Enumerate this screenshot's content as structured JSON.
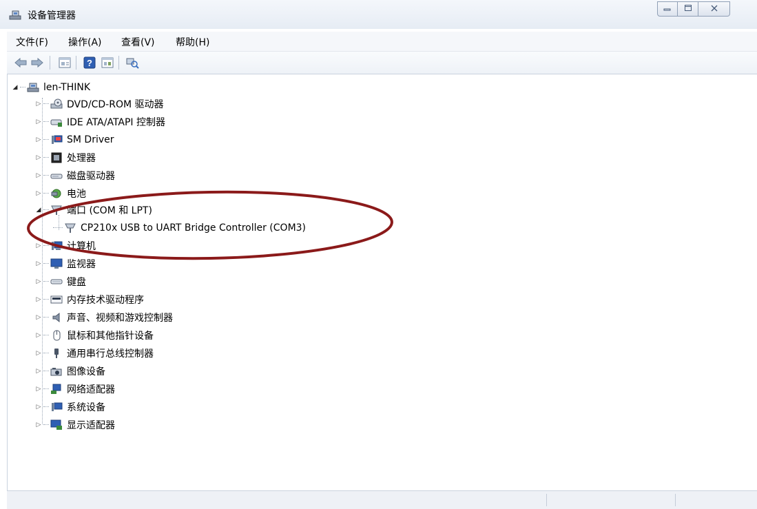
{
  "window": {
    "title": "设备管理器"
  },
  "menu": [
    "文件(F)",
    "操作(A)",
    "查看(V)",
    "帮助(H)"
  ],
  "toolbar": {
    "icons": [
      "back-arrow-icon",
      "forward-arrow-icon",
      "properties-icon",
      "help-icon",
      "show-hidden-icon",
      "scan-hardware-icon"
    ]
  },
  "tree": {
    "root": "len-THINK",
    "categories": [
      {
        "label": "DVD/CD-ROM 驱动器",
        "icon": "dvd-drive-icon",
        "expanded": false
      },
      {
        "label": "IDE ATA/ATAPI 控制器",
        "icon": "ide-controller-icon",
        "expanded": false
      },
      {
        "label": "SM Driver",
        "icon": "sm-driver-icon",
        "expanded": false
      },
      {
        "label": "处理器",
        "icon": "processor-icon",
        "expanded": false
      },
      {
        "label": "磁盘驱动器",
        "icon": "disk-drive-icon",
        "expanded": false
      },
      {
        "label": "电池",
        "icon": "battery-icon",
        "expanded": false
      },
      {
        "label": "端口 (COM 和 LPT)",
        "icon": "port-icon",
        "expanded": true,
        "children": [
          "CP210x USB to UART Bridge Controller (COM3)"
        ]
      },
      {
        "label": "计算机",
        "icon": "computer-icon",
        "expanded": false
      },
      {
        "label": "监视器",
        "icon": "monitor-icon",
        "expanded": false
      },
      {
        "label": "键盘",
        "icon": "keyboard-icon",
        "expanded": false
      },
      {
        "label": "内存技术驱动程序",
        "icon": "memory-icon",
        "expanded": false
      },
      {
        "label": "声音、视频和游戏控制器",
        "icon": "speaker-icon",
        "expanded": false
      },
      {
        "label": "鼠标和其他指针设备",
        "icon": "mouse-icon",
        "expanded": false
      },
      {
        "label": "通用串行总线控制器",
        "icon": "usb-icon",
        "expanded": false
      },
      {
        "label": "图像设备",
        "icon": "camera-icon",
        "expanded": false
      },
      {
        "label": "网络适配器",
        "icon": "network-adapter-icon",
        "expanded": false
      },
      {
        "label": "系统设备",
        "icon": "system-device-icon",
        "expanded": false
      },
      {
        "label": "显示适配器",
        "icon": "display-adapter-icon",
        "expanded": false
      }
    ]
  },
  "colors": {
    "highlight_ellipse": "#8b1a1a",
    "accent": "#3a6fbf"
  }
}
